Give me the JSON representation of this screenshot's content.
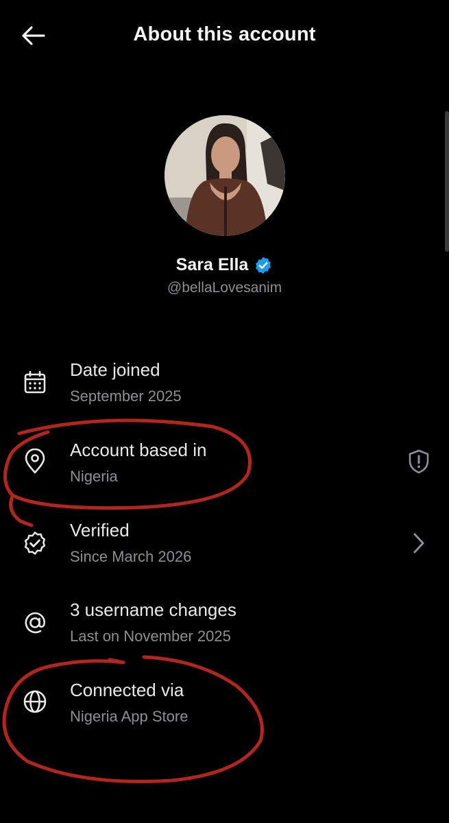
{
  "header": {
    "title": "About this account",
    "back_icon": "arrow-left-icon"
  },
  "profile": {
    "display_name": "Sara Ella",
    "handle": "@bellaLovesanim",
    "verified_badge_color": "#1d9bf0"
  },
  "rows": [
    {
      "icon": "calendar-icon",
      "title": "Date joined",
      "subtitle": "September 2025"
    },
    {
      "icon": "location-pin-icon",
      "title": "Account based in",
      "subtitle": "Nigeria",
      "end_icon": "shield-alert-icon"
    },
    {
      "icon": "verified-badge-icon",
      "title": "Verified",
      "subtitle": "Since March 2026",
      "end_icon": "chevron-right-icon"
    },
    {
      "icon": "at-sign-icon",
      "title": "3 username changes",
      "subtitle": "Last on November 2025"
    },
    {
      "icon": "globe-icon",
      "title": "Connected via",
      "subtitle": "Nigeria App Store"
    }
  ],
  "colors": {
    "background": "#000000",
    "primary_text": "#e7e9ea",
    "secondary_text": "#8b9096",
    "annotation_red": "#b3261e"
  }
}
